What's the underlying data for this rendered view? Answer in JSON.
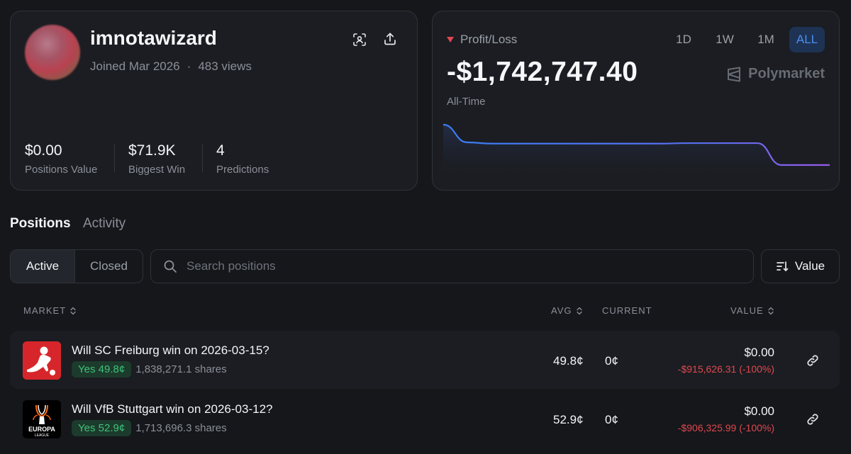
{
  "profile": {
    "username": "imnotawizard",
    "joined": "Joined Mar 2026",
    "views": "483 views",
    "stats": [
      {
        "value": "$0.00",
        "label": "Positions Value"
      },
      {
        "value": "$71.9K",
        "label": "Biggest Win"
      },
      {
        "value": "4",
        "label": "Predictions"
      }
    ],
    "icons": {
      "scan": "scan-user-icon",
      "share": "upload-share-icon"
    }
  },
  "pnl": {
    "label": "Profit/Loss",
    "value": "-$1,742,747.40",
    "period": "All-Time",
    "brand": "Polymarket",
    "ranges": [
      "1D",
      "1W",
      "1M",
      "ALL"
    ],
    "active_range": "ALL",
    "trend_color": "#e0484f",
    "sparkline": [
      -0.1,
      -0.82,
      -0.87,
      -0.87,
      -0.87,
      -0.87,
      -0.87,
      -0.87,
      -0.87,
      -0.87,
      -0.85,
      -0.85,
      -0.85,
      -0.85,
      -1.74,
      -1.74,
      -1.74
    ]
  },
  "tabs": {
    "positions": "Positions",
    "activity": "Activity"
  },
  "filters": {
    "active": "Active",
    "closed": "Closed",
    "search_placeholder": "Search positions",
    "sort_label": "Value"
  },
  "table": {
    "headers": {
      "market": "MARKET",
      "avg": "AVG",
      "current": "CURRENT",
      "value": "VALUE"
    },
    "rows": [
      {
        "title": "Will SC Freiburg win on 2026-03-15?",
        "outcome": "Yes 49.8¢",
        "shares": "1,838,271.1 shares",
        "avg": "49.8¢",
        "current": "0¢",
        "value": "$0.00",
        "pnl": "-$915,626.31 (-100%)",
        "logo": "bundesliga-logo"
      },
      {
        "title": "Will VfB Stuttgart win on 2026-03-12?",
        "outcome": "Yes 52.9¢",
        "shares": "1,713,696.3 shares",
        "avg": "52.9¢",
        "current": "0¢",
        "value": "$0.00",
        "pnl": "-$906,325.99 (-100%)",
        "logo": "europa-league-logo",
        "logo_text": "EUROPA",
        "logo_subtext": "LEAGUE"
      }
    ]
  },
  "colors": {
    "accent": "#4d8df0",
    "positive": "#3fc27a",
    "negative": "#e0484f"
  }
}
